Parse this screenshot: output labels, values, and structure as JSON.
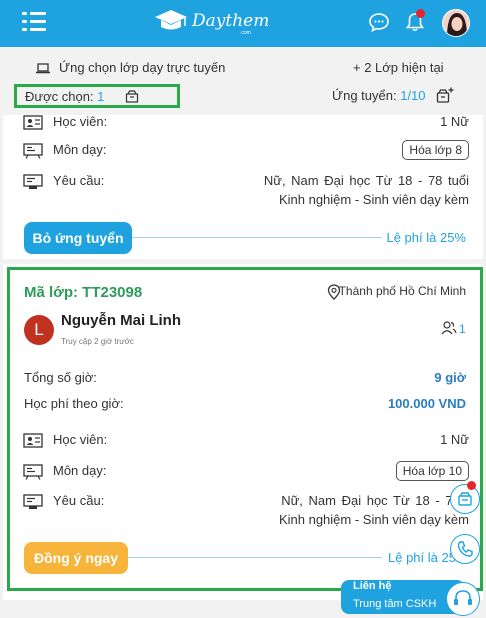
{
  "header": {
    "menu_icon": "hamburger-menu-icon",
    "logo_text": "Daythem",
    "logo_sub": ".com",
    "icons": [
      "chat-bubble-icon",
      "bell-icon"
    ],
    "notification_dot_color": "#e8232b",
    "accent_color": "#1ea3e0"
  },
  "infobar": {
    "online_label": "Ứng chọn lớp dạy trực tuyến",
    "current_classes": "+ 2 Lớp hiện tại",
    "chosen_label": "Được chọn:",
    "chosen_count": "1",
    "apply_label": "Ứng tuyển:",
    "apply_count": "1/10"
  },
  "card1": {
    "student_label": "Học viên:",
    "student_value": "1 Nữ",
    "subject_label": "Môn dạy:",
    "subject_value": "Hóa lớp 8",
    "require_label": "Yêu cầu:",
    "require_line1": "Nữ, Nam   Đại học   Từ 18 - 78 tuổi",
    "require_line2": "Kinh nghiệm - Sinh viên dạy kèm",
    "button_label": "Bỏ ứng tuyển",
    "fee": "Lệ phí là 25%"
  },
  "card2": {
    "code": "Mã lớp: TT23098",
    "location": "Thành phố Hồ Chí Minh",
    "avatar_letter": "L",
    "name": "Nguyễn Mai Linh",
    "access": "Truy cập 2 giờ trước",
    "people_count": "1",
    "hours_label": "Tổng số giờ:",
    "hours_value": "9 giờ",
    "fee_hour_label": "Học phí theo giờ:",
    "fee_hour_value": "100.000 VND",
    "student_label": "Học viên:",
    "student_value": "1 Nữ",
    "subject_label": "Môn dạy:",
    "subject_value": "Hóa lớp 10",
    "require_label": "Yêu cầu:",
    "require_line1": "Nữ, Nam   Đại học   Từ 18 - 78 t",
    "require_line2": "Kinh nghiệm - Sinh viên dạy kèm",
    "button_label": "Đồng ý ngay",
    "fee": "Lệ phí là 25"
  },
  "support": {
    "title": "Liên hệ",
    "subtitle": "Trung tâm CSKH"
  },
  "highlight_color": "#2aa84a"
}
